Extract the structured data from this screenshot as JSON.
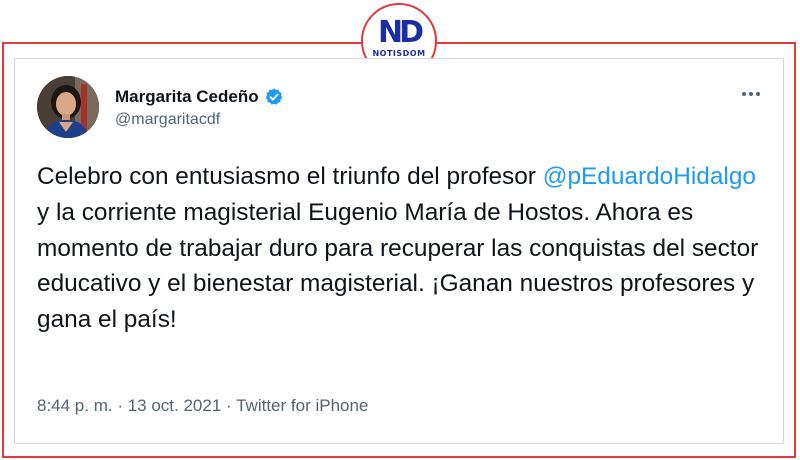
{
  "logo": {
    "mark": "ND",
    "name": "NOTISDOM"
  },
  "tweet": {
    "author_name": "Margarita Cedeño",
    "handle": "@margaritacdf",
    "verified_icon": "verified-badge-icon",
    "more_icon": "more-options-icon",
    "text_before_mention": "Celebro con entusiasmo el triunfo del profesor ",
    "mention": "@pEduardoHidalgo",
    "text_after_mention": " y la corriente magisterial Eugenio María de Hostos. Ahora es momento de trabajar duro para recuperar las conquistas del sector educativo y el bienestar magisterial. ¡Ganan nuestros profesores y gana el país!",
    "time": "8:44 p. m.",
    "date": "13 oct. 2021",
    "source": "Twitter for iPhone",
    "separator": " · "
  },
  "colors": {
    "frame_red": "#e03a3e",
    "logo_blue": "#1b2fa3",
    "twitter_blue": "#1d9bf0",
    "text": "#0f1419",
    "secondary_text": "#536471"
  }
}
